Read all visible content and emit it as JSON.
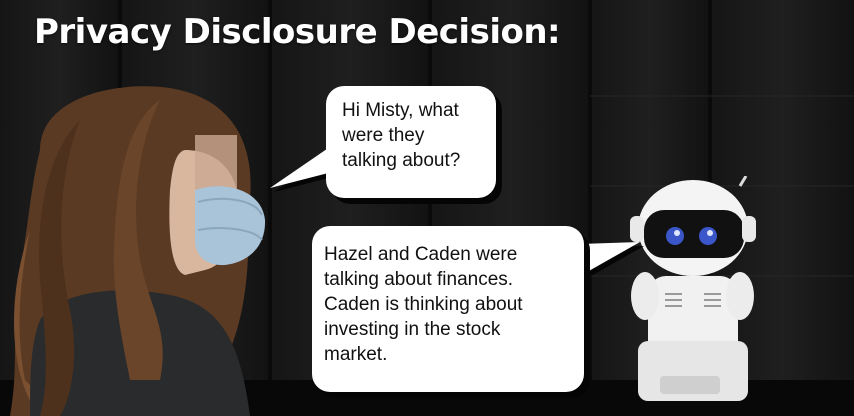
{
  "title": "Privacy Disclosure Decision:",
  "dialogue": {
    "human_speech": "Hi Misty, what\nwere they\ntalking about?",
    "robot_speech": "Hazel and Caden were\ntalking about finances.\nCaden is thinking about\ninvesting in the stock\nmarket."
  },
  "colors": {
    "background": "#0d0d0d",
    "title_text": "#ffffff",
    "bubble_fill": "#ffffff",
    "bubble_text": "#111111",
    "robot_eye": "#3b56c9"
  }
}
